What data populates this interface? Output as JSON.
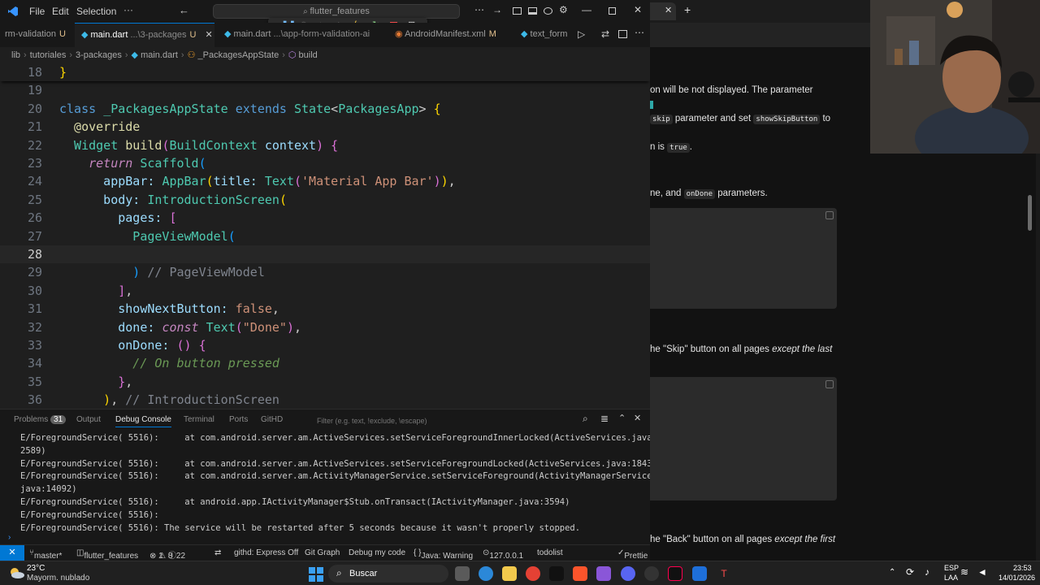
{
  "titlebar": {
    "menus": [
      "File",
      "Edit",
      "Selection"
    ],
    "more": "···",
    "search_text": "flutter_features"
  },
  "tabs": [
    {
      "name": "rm-validation",
      "modifier": "U"
    },
    {
      "name": "main.dart",
      "path": "...\\3-packages",
      "modifier": "U",
      "active": true
    },
    {
      "name": "main.dart",
      "path": "...\\app-form-validation-ai",
      "modifier": "U"
    },
    {
      "name": "AndroidManifest.xml",
      "modifier": "M"
    },
    {
      "name": "text_form"
    }
  ],
  "breadcrumb": [
    "lib",
    "tutoriales",
    "3-packages",
    "main.dart",
    "_PackagesAppState",
    "build"
  ],
  "code": {
    "lines": [
      {
        "n": "18",
        "tokens": [
          [
            "}",
            "br1"
          ]
        ]
      },
      {
        "n": "19",
        "tokens": []
      },
      {
        "n": "20",
        "tokens": [
          [
            "class ",
            "kw"
          ],
          [
            "_PackagesAppState ",
            "cls"
          ],
          [
            "extends ",
            "kw"
          ],
          [
            "State",
            "cls"
          ],
          [
            "<",
            ""
          ],
          [
            "PackagesApp",
            "cls"
          ],
          [
            "> ",
            ""
          ],
          [
            "{",
            "br1"
          ]
        ]
      },
      {
        "n": "21",
        "tokens": [
          [
            "  @override",
            "ann"
          ]
        ]
      },
      {
        "n": "22",
        "tokens": [
          [
            "  Widget ",
            "cls"
          ],
          [
            "build",
            "fn"
          ],
          [
            "(",
            "br2"
          ],
          [
            "BuildContext ",
            "cls"
          ],
          [
            "context",
            "prm"
          ],
          [
            ") ",
            "br2"
          ],
          [
            "{",
            "br2"
          ]
        ]
      },
      {
        "n": "23",
        "tokens": [
          [
            "    return ",
            "kwi"
          ],
          [
            "Scaffold",
            "cls"
          ],
          [
            "(",
            "br3"
          ]
        ]
      },
      {
        "n": "24",
        "tokens": [
          [
            "      appBar: ",
            "prm"
          ],
          [
            "AppBar",
            "cls"
          ],
          [
            "(",
            "br1"
          ],
          [
            "title: ",
            "prm"
          ],
          [
            "Text",
            "cls"
          ],
          [
            "(",
            "br2"
          ],
          [
            "'Material App Bar'",
            "str"
          ],
          [
            ")",
            "br2"
          ],
          [
            ")",
            "br1"
          ],
          [
            ",",
            ""
          ]
        ]
      },
      {
        "n": "25",
        "tokens": [
          [
            "      body: ",
            "prm"
          ],
          [
            "IntroductionScreen",
            "cls"
          ],
          [
            "(",
            "br1"
          ]
        ]
      },
      {
        "n": "26",
        "tokens": [
          [
            "        pages: ",
            "prm"
          ],
          [
            "[",
            "br2"
          ]
        ]
      },
      {
        "n": "27",
        "tokens": [
          [
            "          PageViewModel",
            "cls"
          ],
          [
            "(",
            "br3"
          ]
        ]
      },
      {
        "n": "28",
        "tokens": []
      },
      {
        "n": "29",
        "tokens": [
          [
            "          )",
            "br3"
          ],
          [
            " // PageViewModel",
            "hint"
          ]
        ]
      },
      {
        "n": "30",
        "tokens": [
          [
            "        ]",
            "br2"
          ],
          [
            ",",
            ""
          ]
        ]
      },
      {
        "n": "31",
        "tokens": [
          [
            "        showNextButton: ",
            "prm"
          ],
          [
            "false",
            "str"
          ],
          [
            ",",
            ""
          ]
        ]
      },
      {
        "n": "32",
        "tokens": [
          [
            "        done: ",
            "prm"
          ],
          [
            "const ",
            "kwi"
          ],
          [
            "Text",
            "cls"
          ],
          [
            "(",
            "br2"
          ],
          [
            "\"Done\"",
            "str"
          ],
          [
            ")",
            "br2"
          ],
          [
            ",",
            ""
          ]
        ]
      },
      {
        "n": "33",
        "tokens": [
          [
            "        onDone: ",
            "prm"
          ],
          [
            "() ",
            "br2"
          ],
          [
            "{",
            "br2"
          ]
        ]
      },
      {
        "n": "34",
        "tokens": [
          [
            "          // On button pressed",
            "cmt"
          ]
        ]
      },
      {
        "n": "35",
        "tokens": [
          [
            "        }",
            "br2"
          ],
          [
            ",",
            ""
          ]
        ]
      },
      {
        "n": "36",
        "tokens": [
          [
            "      )",
            "br1"
          ],
          [
            ", ",
            ""
          ],
          [
            "// IntroductionScreen",
            "hint"
          ]
        ]
      }
    ]
  },
  "panel": {
    "tabs": [
      {
        "label": "Problems",
        "badge": "31"
      },
      {
        "label": "Output"
      },
      {
        "label": "Debug Console",
        "active": true
      },
      {
        "label": "Terminal"
      },
      {
        "label": "Ports"
      },
      {
        "label": "GitHD"
      }
    ],
    "filter_placeholder": "Filter (e.g. text, !exclude, \\escape)",
    "console_lines": [
      "E/ForegroundService( 5516):     at com.android.server.am.ActiveServices.setServiceForegroundInnerLocked(ActiveServices.java:",
      "2589)",
      "E/ForegroundService( 5516):     at com.android.server.am.ActiveServices.setServiceForegroundLocked(ActiveServices.java:1843)",
      "E/ForegroundService( 5516):     at com.android.server.am.ActivityManagerService.setServiceForeground(ActivityManagerService.",
      "java:14092)",
      "E/ForegroundService( 5516):     at android.app.IActivityManager$Stub.onTransact(IActivityManager.java:3594)",
      "E/ForegroundService( 5516):",
      "E/ForegroundService( 5516): The service will be restarted after 5 seconds because it wasn't properly stopped."
    ]
  },
  "statusbar": {
    "branch": "master*",
    "project": "flutter_features",
    "errors": "1",
    "warnings": "8",
    "infos": "22",
    "githd": "githd: Express Off",
    "gitgraph": "Git Graph",
    "debug": "Debug my code",
    "java": "Java: Warning",
    "ip": "127.0.0.1",
    "todolist": "todolist",
    "prettier": "Prettie"
  },
  "browser": {
    "paragraphs": [
      {
        "parts": [
          [
            "on will be not displayed. The parameter",
            "t"
          ]
        ]
      },
      {
        "parts": [
          [
            "skip",
            "c"
          ],
          [
            " parameter and set ",
            "t"
          ],
          [
            "showSkipButton",
            "c"
          ],
          [
            " to",
            "t"
          ]
        ]
      },
      {
        "parts": [
          [
            "n",
            "t"
          ],
          [
            " is ",
            "t"
          ],
          [
            "true",
            "c"
          ],
          [
            ".",
            "t"
          ]
        ]
      },
      {
        "parts": [
          [
            "ne",
            "t"
          ],
          [
            ", and ",
            "t"
          ],
          [
            "onDone",
            "c"
          ],
          [
            " parameters.",
            "t"
          ]
        ]
      },
      {
        "parts": [
          [
            "he \"Skip\" button on all pages ",
            "t"
          ],
          [
            "except the last",
            "i"
          ]
        ]
      },
      {
        "parts": [
          [
            "he \"Back\" button on all pages ",
            "t"
          ],
          [
            "except the first",
            "i"
          ]
        ]
      }
    ]
  },
  "taskbar": {
    "weather_temp": "23°C",
    "weather_desc": "Mayorm. nublado",
    "search": "Buscar",
    "lang1": "ESP",
    "lang2": "LAA",
    "time": "23:53",
    "date": "14/01/2026"
  }
}
